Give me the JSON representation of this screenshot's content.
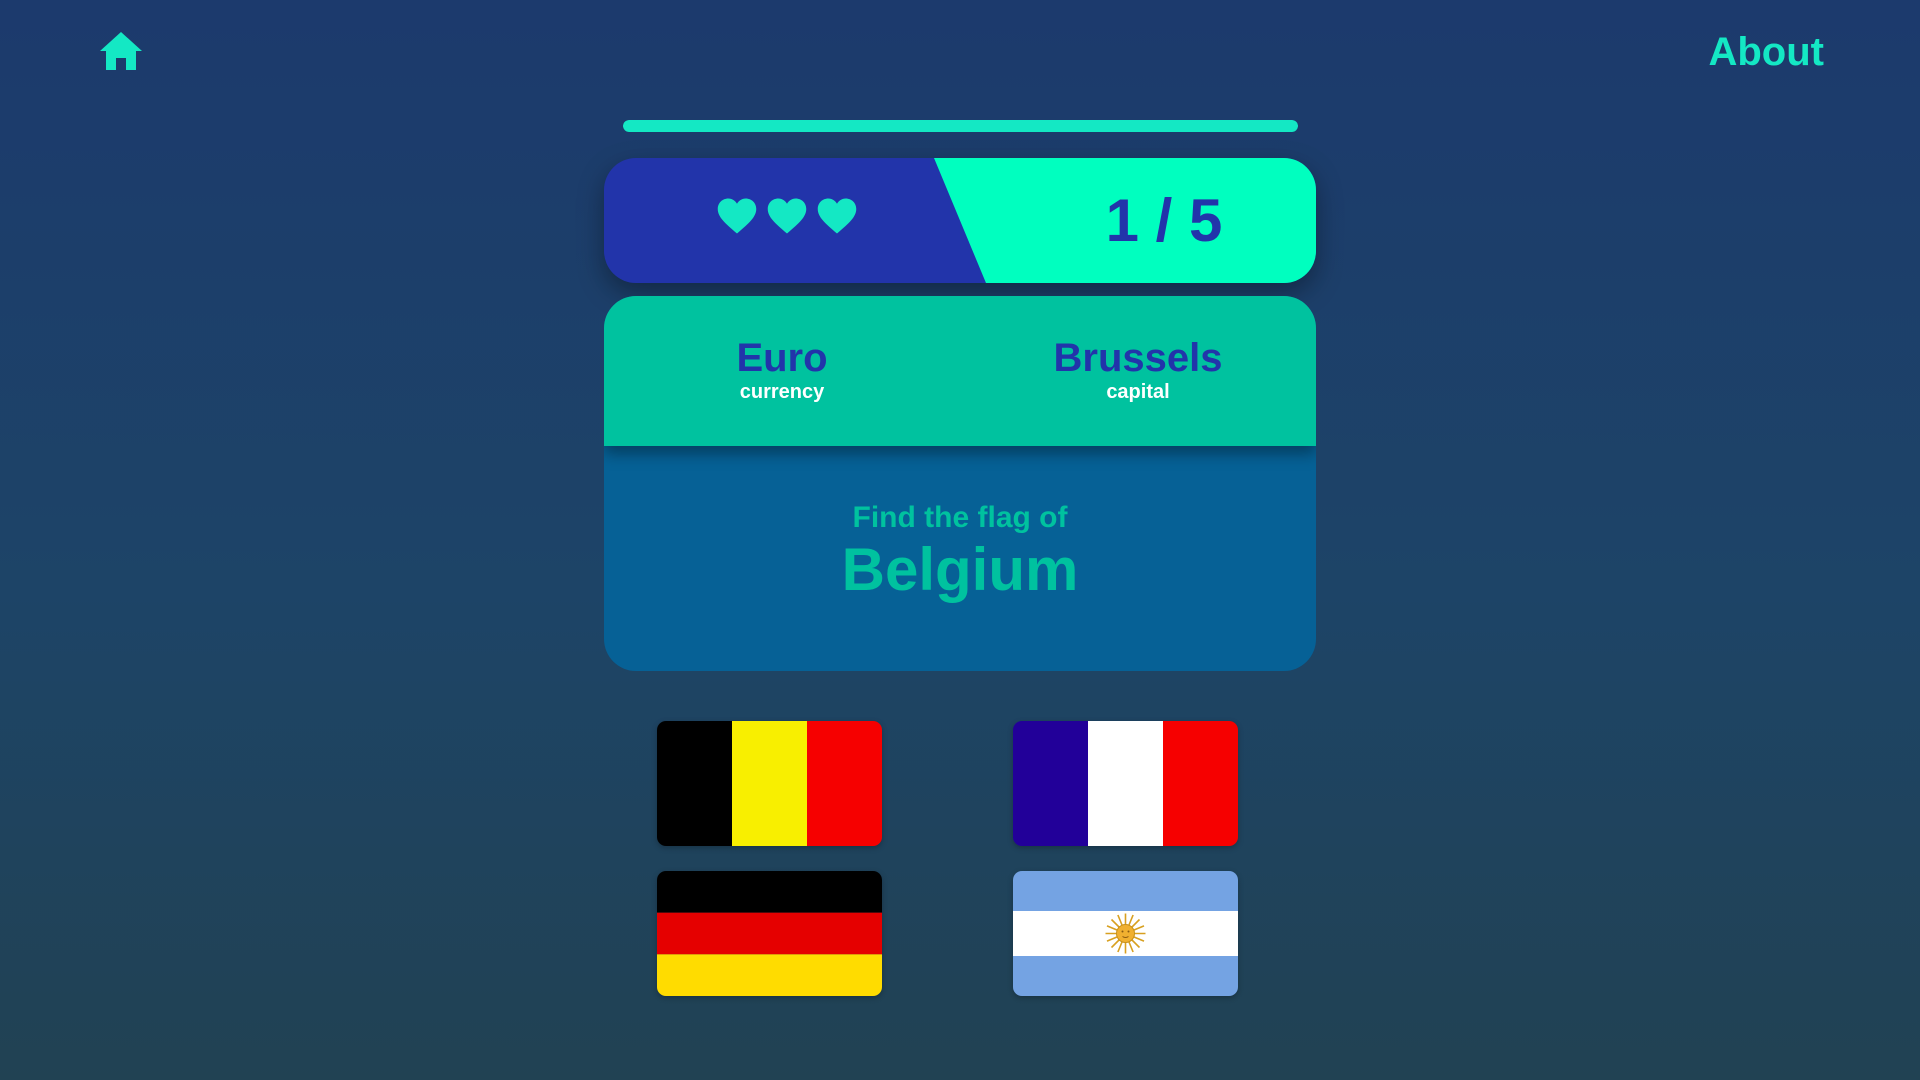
{
  "nav": {
    "home_icon": "home-icon",
    "about_label": "About"
  },
  "progress": {
    "value": 1,
    "total": 5,
    "fill_fraction": 1.0
  },
  "status": {
    "lives": 3,
    "heart_icon": "heart-icon",
    "score_text": "1 / 5"
  },
  "clues": {
    "currency_value": "Euro",
    "currency_label": "currency",
    "capital_value": "Brussels",
    "capital_label": "capital"
  },
  "question": {
    "prompt": "Find the flag of",
    "country": "Belgium"
  },
  "options": [
    {
      "flag": "belgium-flag"
    },
    {
      "flag": "france-flag"
    },
    {
      "flag": "germany-flag"
    },
    {
      "flag": "argentina-flag"
    }
  ],
  "colors": {
    "accent": "#14e8c4",
    "primary_blue": "#2234aa",
    "teal": "#00c29f",
    "panel_blue": "#066196",
    "score_bg": "#00ffbf"
  }
}
